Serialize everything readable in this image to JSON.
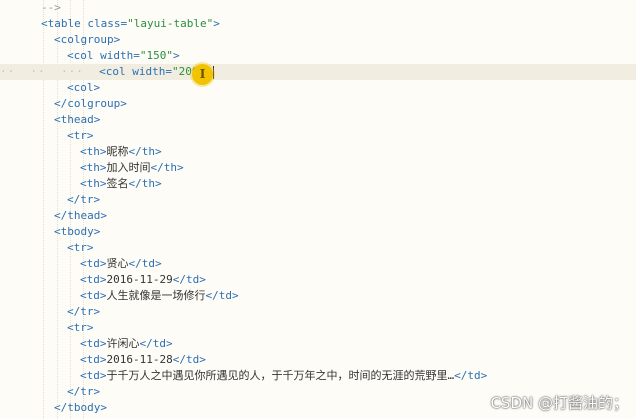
{
  "editor": {
    "lines": [
      {
        "id": "l0",
        "parts": [
          {
            "t": "cmt",
            "v": "-->"
          }
        ]
      },
      {
        "id": "l1",
        "parts": [
          {
            "t": "punc",
            "v": "<"
          },
          {
            "t": "tag",
            "v": "table"
          },
          {
            "t": "attr",
            "v": " class"
          },
          {
            "t": "punc",
            "v": "="
          },
          {
            "t": "str",
            "v": "\"layui-table\""
          },
          {
            "t": "punc",
            "v": ">"
          }
        ]
      },
      {
        "id": "l2",
        "parts": [
          {
            "t": "punc",
            "v": "<"
          },
          {
            "t": "tag",
            "v": "colgroup"
          },
          {
            "t": "punc",
            "v": ">"
          }
        ]
      },
      {
        "id": "l3",
        "parts": [
          {
            "t": "punc",
            "v": "<"
          },
          {
            "t": "tag",
            "v": "col"
          },
          {
            "t": "attr",
            "v": " width"
          },
          {
            "t": "punc",
            "v": "="
          },
          {
            "t": "str",
            "v": "\"150\""
          },
          {
            "t": "punc",
            "v": ">"
          }
        ]
      },
      {
        "id": "l4",
        "parts": [
          {
            "t": "punc",
            "v": "<"
          },
          {
            "t": "tag",
            "v": "col"
          },
          {
            "t": "attr",
            "v": " width"
          },
          {
            "t": "punc",
            "v": "="
          },
          {
            "t": "str",
            "v": "\"200\""
          },
          {
            "t": "punc",
            "v": ">"
          }
        ]
      },
      {
        "id": "l5",
        "parts": [
          {
            "t": "punc",
            "v": "<"
          },
          {
            "t": "tag",
            "v": "col"
          },
          {
            "t": "punc",
            "v": ">"
          }
        ]
      },
      {
        "id": "l6",
        "parts": [
          {
            "t": "punc",
            "v": "</"
          },
          {
            "t": "tag",
            "v": "colgroup"
          },
          {
            "t": "punc",
            "v": ">"
          }
        ]
      },
      {
        "id": "l7",
        "parts": [
          {
            "t": "punc",
            "v": "<"
          },
          {
            "t": "tag",
            "v": "thead"
          },
          {
            "t": "punc",
            "v": ">"
          }
        ]
      },
      {
        "id": "l8",
        "parts": [
          {
            "t": "punc",
            "v": "<"
          },
          {
            "t": "tag",
            "v": "tr"
          },
          {
            "t": "punc",
            "v": ">"
          }
        ]
      },
      {
        "id": "l9",
        "parts": [
          {
            "t": "punc",
            "v": "<"
          },
          {
            "t": "tag",
            "v": "th"
          },
          {
            "t": "punc",
            "v": ">"
          },
          {
            "t": "text",
            "v": "昵称"
          },
          {
            "t": "punc",
            "v": "</"
          },
          {
            "t": "tag",
            "v": "th"
          },
          {
            "t": "punc",
            "v": ">"
          }
        ]
      },
      {
        "id": "l10",
        "parts": [
          {
            "t": "punc",
            "v": "<"
          },
          {
            "t": "tag",
            "v": "th"
          },
          {
            "t": "punc",
            "v": ">"
          },
          {
            "t": "text",
            "v": "加入时间"
          },
          {
            "t": "punc",
            "v": "</"
          },
          {
            "t": "tag",
            "v": "th"
          },
          {
            "t": "punc",
            "v": ">"
          }
        ]
      },
      {
        "id": "l11",
        "parts": [
          {
            "t": "punc",
            "v": "<"
          },
          {
            "t": "tag",
            "v": "th"
          },
          {
            "t": "punc",
            "v": ">"
          },
          {
            "t": "text",
            "v": "签名"
          },
          {
            "t": "punc",
            "v": "</"
          },
          {
            "t": "tag",
            "v": "th"
          },
          {
            "t": "punc",
            "v": ">"
          }
        ]
      },
      {
        "id": "l12",
        "parts": [
          {
            "t": "punc",
            "v": "</"
          },
          {
            "t": "tag",
            "v": "tr"
          },
          {
            "t": "punc",
            "v": ">"
          }
        ]
      },
      {
        "id": "l13",
        "parts": [
          {
            "t": "punc",
            "v": "</"
          },
          {
            "t": "tag",
            "v": "thead"
          },
          {
            "t": "punc",
            "v": ">"
          }
        ]
      },
      {
        "id": "l14",
        "parts": [
          {
            "t": "punc",
            "v": "<"
          },
          {
            "t": "tag",
            "v": "tbody"
          },
          {
            "t": "punc",
            "v": ">"
          }
        ]
      },
      {
        "id": "l15",
        "parts": [
          {
            "t": "punc",
            "v": "<"
          },
          {
            "t": "tag",
            "v": "tr"
          },
          {
            "t": "punc",
            "v": ">"
          }
        ]
      },
      {
        "id": "l16",
        "parts": [
          {
            "t": "punc",
            "v": "<"
          },
          {
            "t": "tag",
            "v": "td"
          },
          {
            "t": "punc",
            "v": ">"
          },
          {
            "t": "text",
            "v": "贤心"
          },
          {
            "t": "punc",
            "v": "</"
          },
          {
            "t": "tag",
            "v": "td"
          },
          {
            "t": "punc",
            "v": ">"
          }
        ]
      },
      {
        "id": "l17",
        "parts": [
          {
            "t": "punc",
            "v": "<"
          },
          {
            "t": "tag",
            "v": "td"
          },
          {
            "t": "punc",
            "v": ">"
          },
          {
            "t": "text",
            "v": "2016-11-29"
          },
          {
            "t": "punc",
            "v": "</"
          },
          {
            "t": "tag",
            "v": "td"
          },
          {
            "t": "punc",
            "v": ">"
          }
        ]
      },
      {
        "id": "l18",
        "parts": [
          {
            "t": "punc",
            "v": "<"
          },
          {
            "t": "tag",
            "v": "td"
          },
          {
            "t": "punc",
            "v": ">"
          },
          {
            "t": "text",
            "v": "人生就像是一场修行"
          },
          {
            "t": "punc",
            "v": "</"
          },
          {
            "t": "tag",
            "v": "td"
          },
          {
            "t": "punc",
            "v": ">"
          }
        ]
      },
      {
        "id": "l19",
        "parts": [
          {
            "t": "punc",
            "v": "</"
          },
          {
            "t": "tag",
            "v": "tr"
          },
          {
            "t": "punc",
            "v": ">"
          }
        ]
      },
      {
        "id": "l20",
        "parts": [
          {
            "t": "punc",
            "v": "<"
          },
          {
            "t": "tag",
            "v": "tr"
          },
          {
            "t": "punc",
            "v": ">"
          }
        ]
      },
      {
        "id": "l21",
        "parts": [
          {
            "t": "punc",
            "v": "<"
          },
          {
            "t": "tag",
            "v": "td"
          },
          {
            "t": "punc",
            "v": ">"
          },
          {
            "t": "text",
            "v": "许闲心"
          },
          {
            "t": "punc",
            "v": "</"
          },
          {
            "t": "tag",
            "v": "td"
          },
          {
            "t": "punc",
            "v": ">"
          }
        ]
      },
      {
        "id": "l22",
        "parts": [
          {
            "t": "punc",
            "v": "<"
          },
          {
            "t": "tag",
            "v": "td"
          },
          {
            "t": "punc",
            "v": ">"
          },
          {
            "t": "text",
            "v": "2016-11-28"
          },
          {
            "t": "punc",
            "v": "</"
          },
          {
            "t": "tag",
            "v": "td"
          },
          {
            "t": "punc",
            "v": ">"
          }
        ]
      },
      {
        "id": "l23",
        "parts": [
          {
            "t": "punc",
            "v": "<"
          },
          {
            "t": "tag",
            "v": "td"
          },
          {
            "t": "punc",
            "v": ">"
          },
          {
            "t": "text",
            "v": "于千万人之中遇见你所遇见的人，于千万年之中，时间的无涯的荒野里…"
          },
          {
            "t": "punc",
            "v": "</"
          },
          {
            "t": "tag",
            "v": "td"
          },
          {
            "t": "punc",
            "v": ">"
          }
        ]
      },
      {
        "id": "l24",
        "parts": [
          {
            "t": "punc",
            "v": "</"
          },
          {
            "t": "tag",
            "v": "tr"
          },
          {
            "t": "punc",
            "v": ">"
          }
        ]
      },
      {
        "id": "l25",
        "parts": [
          {
            "t": "punc",
            "v": "</"
          },
          {
            "t": "tag",
            "v": "tbody"
          },
          {
            "t": "punc",
            "v": ">"
          }
        ]
      }
    ]
  },
  "colors": {
    "background": "#fdfcf6",
    "tag": "#2d6fb3",
    "string": "#2a8f3e",
    "text": "#333333",
    "current_line": "#f1eee1",
    "cursor_highlight": "#f2c300"
  },
  "cursor_icon": "text-cursor-icon",
  "watermark": "CSDN @打酱油的；"
}
